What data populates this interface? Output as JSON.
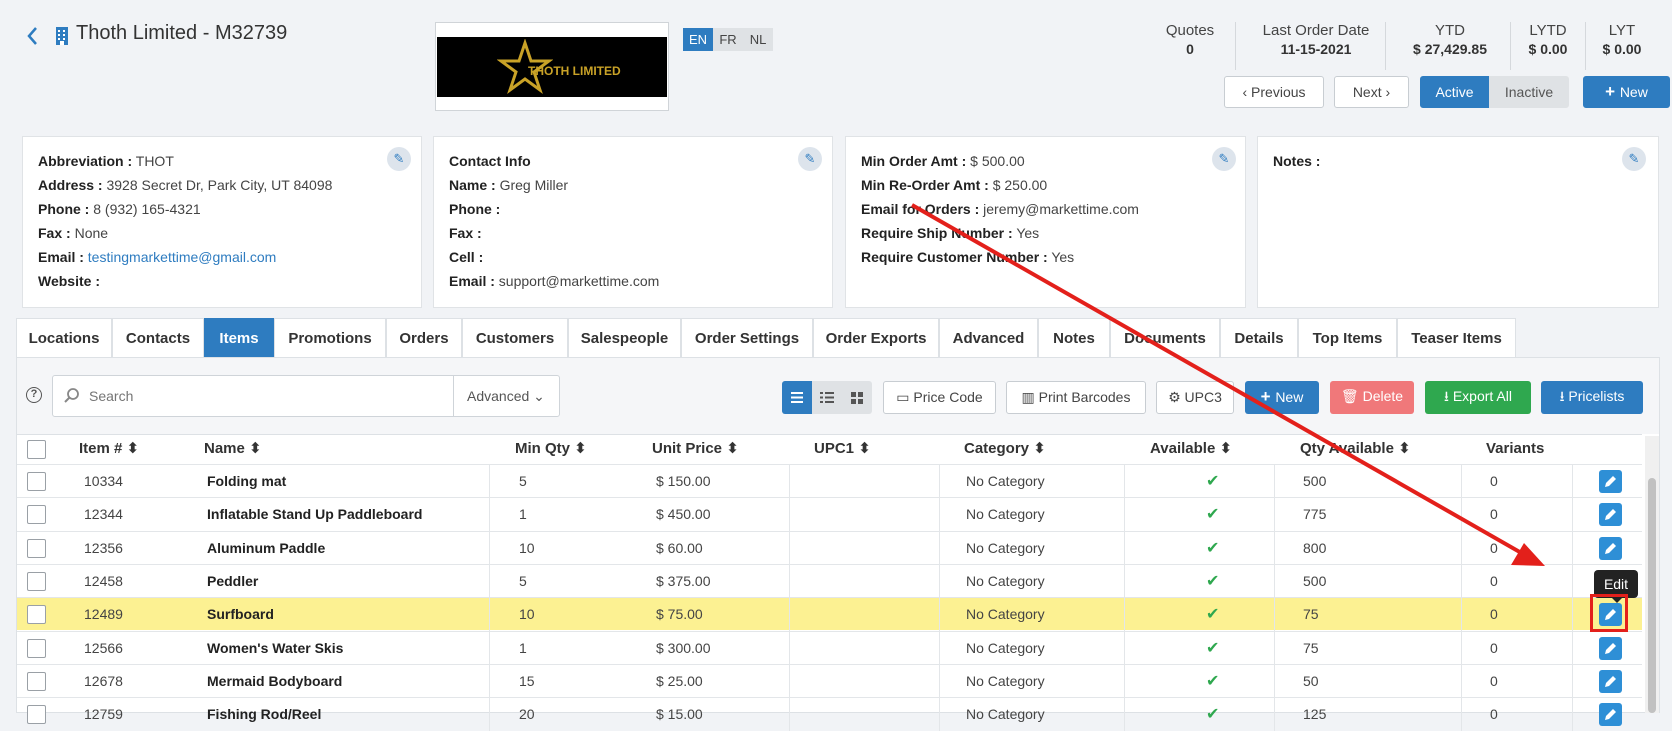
{
  "header": {
    "title": "Thoth Limited - M32739",
    "logo_text": "THOTH LIMITED",
    "languages": [
      "EN",
      "FR",
      "NL"
    ],
    "stats": [
      {
        "label": "Quotes",
        "value": "0"
      },
      {
        "label": "Last Order Date",
        "value": "11-15-2021"
      },
      {
        "label": "YTD",
        "value": "$ 27,429.85"
      },
      {
        "label": "LYTD",
        "value": "$ 0.00"
      },
      {
        "label": "LYT",
        "value": "$ 0.00"
      }
    ],
    "previous_label": "Previous",
    "next_label": "Next",
    "active_label": "Active",
    "inactive_label": "Inactive",
    "new_label": "New"
  },
  "cards": {
    "general": [
      {
        "label": "Abbreviation :",
        "value": "THOT"
      },
      {
        "label": "Address :",
        "value": "3928 Secret Dr, Park City, UT 84098"
      },
      {
        "label": "Phone :",
        "value": "8 (932) 165-4321"
      },
      {
        "label": "Fax :",
        "value": "None"
      },
      {
        "label": "Email :",
        "value": "testingmarkettime@gmail.com"
      },
      {
        "label": "Website :",
        "value": ""
      }
    ],
    "contact": [
      {
        "label": "Contact Info",
        "value": ""
      },
      {
        "label": "Name :",
        "value": "Greg Miller"
      },
      {
        "label": "Phone :",
        "value": ""
      },
      {
        "label": "Fax :",
        "value": ""
      },
      {
        "label": "Cell :",
        "value": ""
      },
      {
        "label": "Email :",
        "value": "support@markettime.com"
      }
    ],
    "orders": [
      {
        "label": "Min Order Amt :",
        "value": "$ 500.00"
      },
      {
        "label": "Min Re-Order Amt :",
        "value": "$ 250.00"
      },
      {
        "label": "Email for Orders :",
        "value": "jeremy@markettime.com"
      },
      {
        "label": "Require Ship Number :",
        "value": "Yes"
      },
      {
        "label": "Require Customer Number :",
        "value": "Yes"
      }
    ],
    "notes": [
      {
        "label": "Notes :",
        "value": ""
      }
    ]
  },
  "tabs": [
    "Locations",
    "Contacts",
    "Items",
    "Promotions",
    "Orders",
    "Customers",
    "Salespeople",
    "Order Settings",
    "Order Exports",
    "Advanced",
    "Notes",
    "Documents",
    "Details",
    "Top Items",
    "Teaser Items"
  ],
  "active_tab": "Items",
  "toolbar": {
    "search_placeholder": "Search",
    "advanced_label": "Advanced",
    "price_code_label": "Price Code",
    "print_barcodes_label": "Print Barcodes",
    "upc_label": "UPC3",
    "new_label": "New",
    "delete_label": "Delete",
    "export_all_label": "Export All",
    "pricelists_label": "Pricelists"
  },
  "table": {
    "columns": [
      "Item #",
      "Name",
      "Min Qty",
      "Unit Price",
      "UPC1",
      "Category",
      "Available",
      "Qty Available",
      "Variants"
    ],
    "rows": [
      {
        "item": "10334",
        "name": "Folding mat",
        "min_qty": "5",
        "price": "$ 150.00",
        "upc": "",
        "category": "No Category",
        "available": true,
        "qty": "500",
        "variants": "0"
      },
      {
        "item": "12344",
        "name": "Inflatable Stand Up Paddleboard",
        "min_qty": "1",
        "price": "$ 450.00",
        "upc": "",
        "category": "No Category",
        "available": true,
        "qty": "775",
        "variants": "0"
      },
      {
        "item": "12356",
        "name": "Aluminum Paddle",
        "min_qty": "10",
        "price": "$ 60.00",
        "upc": "",
        "category": "No Category",
        "available": true,
        "qty": "800",
        "variants": "0"
      },
      {
        "item": "12458",
        "name": "Peddler",
        "min_qty": "5",
        "price": "$ 375.00",
        "upc": "",
        "category": "No Category",
        "available": true,
        "qty": "500",
        "variants": "0"
      },
      {
        "item": "12489",
        "name": "Surfboard",
        "min_qty": "10",
        "price": "$ 75.00",
        "upc": "",
        "category": "No Category",
        "available": true,
        "qty": "75",
        "variants": "0"
      },
      {
        "item": "12566",
        "name": "Women's Water Skis",
        "min_qty": "1",
        "price": "$ 300.00",
        "upc": "",
        "category": "No Category",
        "available": true,
        "qty": "75",
        "variants": "0"
      },
      {
        "item": "12678",
        "name": "Mermaid Bodyboard",
        "min_qty": "15",
        "price": "$ 25.00",
        "upc": "",
        "category": "No Category",
        "available": true,
        "qty": "50",
        "variants": "0"
      },
      {
        "item": "12759",
        "name": "Fishing Rod/Reel",
        "min_qty": "20",
        "price": "$ 15.00",
        "upc": "",
        "category": "No Category",
        "available": true,
        "qty": "125",
        "variants": "0"
      }
    ],
    "highlighted_row": 4
  },
  "tooltip": "Edit",
  "colors": {
    "primary": "#2e7cc0",
    "success": "#2fa84f",
    "danger": "#f0787a",
    "highlight_row": "#fcf192",
    "annotation": "#e3201b"
  }
}
